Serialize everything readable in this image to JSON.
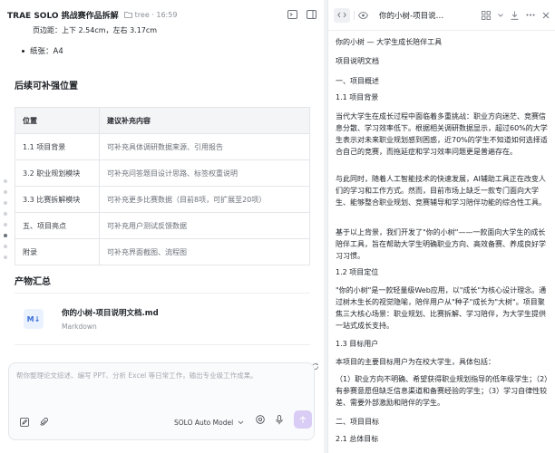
{
  "header": {
    "app_title": "TRAE SOLO 挑战赛作品拆解",
    "folder_label": "tree · 16:59"
  },
  "left": {
    "cut_line": "页边距：上下 2.54cm，左右 3.17cm",
    "bullet_paper": "纸张：A4",
    "section_title": "后续可补强位置",
    "table": {
      "headers": [
        "位置",
        "建议补充内容"
      ],
      "rows": [
        [
          "1.1 项目背景",
          "可补充具体调研数据来源、引用报告"
        ],
        [
          "3.2 职业规划模块",
          "可补充问答题目设计思路、标签权重说明"
        ],
        [
          "3.3 比赛拆解模块",
          "可补充更多比赛数据（目前8项，可扩展至20项）"
        ],
        [
          "五、项目亮点",
          "可补充用户测试反馈数据"
        ],
        [
          "附录",
          "可补充界面截图、流程图"
        ]
      ]
    },
    "deliverables_title": "产物汇总",
    "file": {
      "icon_text": "M↓",
      "name": "你的小树-项目说明文档.md",
      "type": "Markdown"
    }
  },
  "input": {
    "placeholder": "帮你整理论文综述、编写 PPT、分析 Excel 等日常工作，输出专业级工作成果。",
    "model": "SOLO Auto Model"
  },
  "right": {
    "doc_title": "你的小树-项目说…",
    "lines": [
      "你的小树 — 大学生成长陪伴工具",
      "项目说明文档",
      "一、项目概述",
      "1.1 项目背景",
      "当代大学生在成长过程中面临着多重挑战：职业方向迷茫、竞赛信息分散、学习效率低下。根据相关调研数据显示，超过60%的大学生表示对未来职业规划感到困惑，近70%的学生不知道如何选择适合自己的竞赛，而拖延症和学习效率问题更是普遍存在。",
      "与此同时，随着人工智能技术的快速发展，AI辅助工具正在改变人们的学习和工作方式。然而，目前市场上缺乏一款专门面向大学生、能够整合职业规划、竞赛辅导和学习陪伴功能的综合性工具。",
      "基于以上背景，我们开发了\"你的小树\"——一款面向大学生的成长陪伴工具，旨在帮助大学生明确职业方向、高效备赛、养成良好学习习惯。",
      "1.2 项目定位",
      "\"你的小树\"是一款轻量级Web应用，以\"成长\"为核心设计理念。通过树木生长的视觉隐喻，陪伴用户从\"种子\"成长为\"大树\"。项目聚焦三大核心场景：职业规划、比赛拆解、学习陪伴，为大学生提供一站式成长支持。",
      "1.3 目标用户",
      "本项目的主要目标用户为在校大学生，具体包括：",
      "（1）职业方向不明确、希望获得职业规划指导的低年级学生；（2）有参赛意愿但缺乏信息渠道和备赛经验的学生；（3）学习自律性较差、需要外部激励和陪伴的学生。",
      "二、项目目标",
      "2.1 总体目标"
    ]
  }
}
